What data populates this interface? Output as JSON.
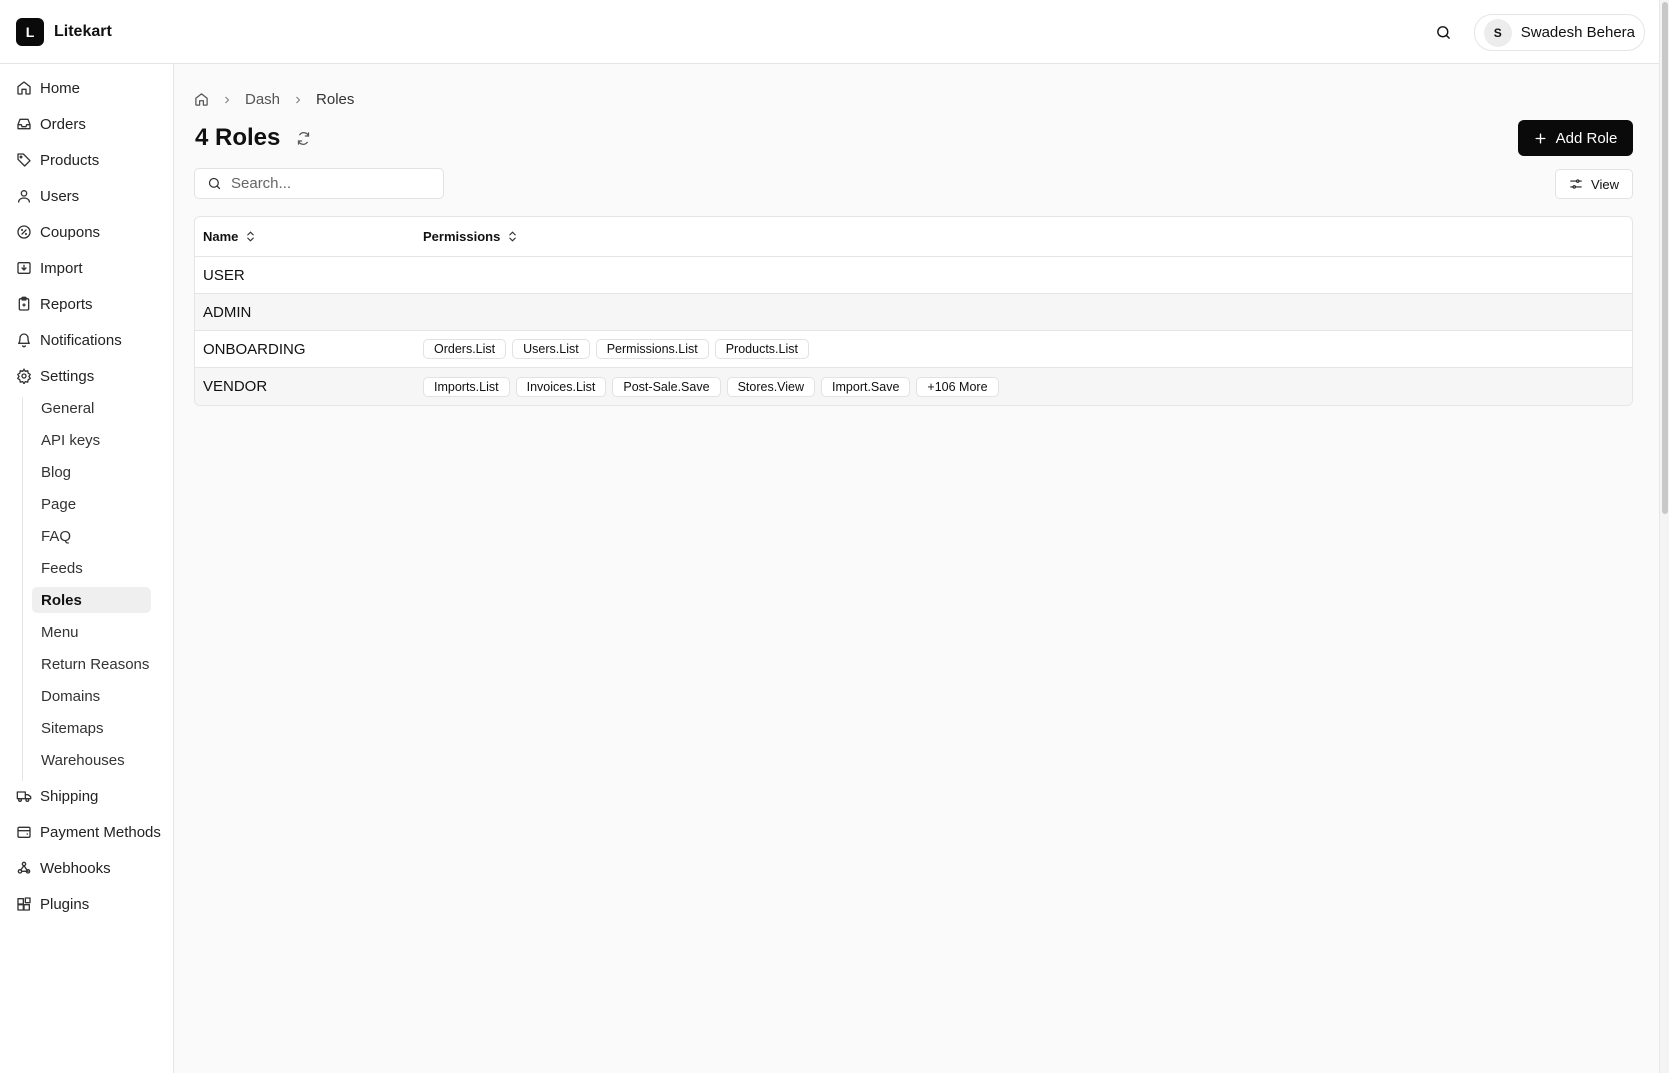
{
  "app": {
    "logo_letter": "L",
    "name": "Litekart"
  },
  "header": {
    "user_initial": "S",
    "user_name": "Swadesh Behera"
  },
  "sidebar": {
    "items": [
      {
        "label": "Home",
        "icon": "home-icon"
      },
      {
        "label": "Orders",
        "icon": "inbox-icon"
      },
      {
        "label": "Products",
        "icon": "tag-icon"
      },
      {
        "label": "Users",
        "icon": "user-icon"
      },
      {
        "label": "Coupons",
        "icon": "badge-percent-icon"
      },
      {
        "label": "Import",
        "icon": "import-icon"
      },
      {
        "label": "Reports",
        "icon": "clipboard-icon"
      },
      {
        "label": "Notifications",
        "icon": "bell-icon"
      },
      {
        "label": "Settings",
        "icon": "gear-icon"
      }
    ],
    "settings_sub": [
      "General",
      "API keys",
      "Blog",
      "Page",
      "FAQ",
      "Feeds",
      "Roles",
      "Menu",
      "Return Reasons",
      "Domains",
      "Sitemaps",
      "Warehouses"
    ],
    "active_sub": "Roles",
    "bottom_items": [
      {
        "label": "Shipping",
        "icon": "truck-icon"
      },
      {
        "label": "Payment Methods",
        "icon": "wallet-icon"
      },
      {
        "label": "Webhooks",
        "icon": "webhook-icon"
      },
      {
        "label": "Plugins",
        "icon": "blocks-icon"
      }
    ]
  },
  "breadcrumb": {
    "dash": "Dash",
    "current": "Roles"
  },
  "page": {
    "title": "4 Roles",
    "add_button": "Add Role",
    "view_button": "View",
    "search_placeholder": "Search..."
  },
  "table": {
    "columns": [
      "Name",
      "Permissions"
    ],
    "rows": [
      {
        "name": "USER",
        "permissions": []
      },
      {
        "name": "ADMIN",
        "permissions": []
      },
      {
        "name": "ONBOARDING",
        "permissions": [
          "Orders.List",
          "Users.List",
          "Permissions.List",
          "Products.List"
        ]
      },
      {
        "name": "VENDOR",
        "permissions": [
          "Imports.List",
          "Invoices.List",
          "Post-Sale.Save",
          "Stores.View",
          "Import.Save",
          "+106 More"
        ]
      }
    ]
  }
}
